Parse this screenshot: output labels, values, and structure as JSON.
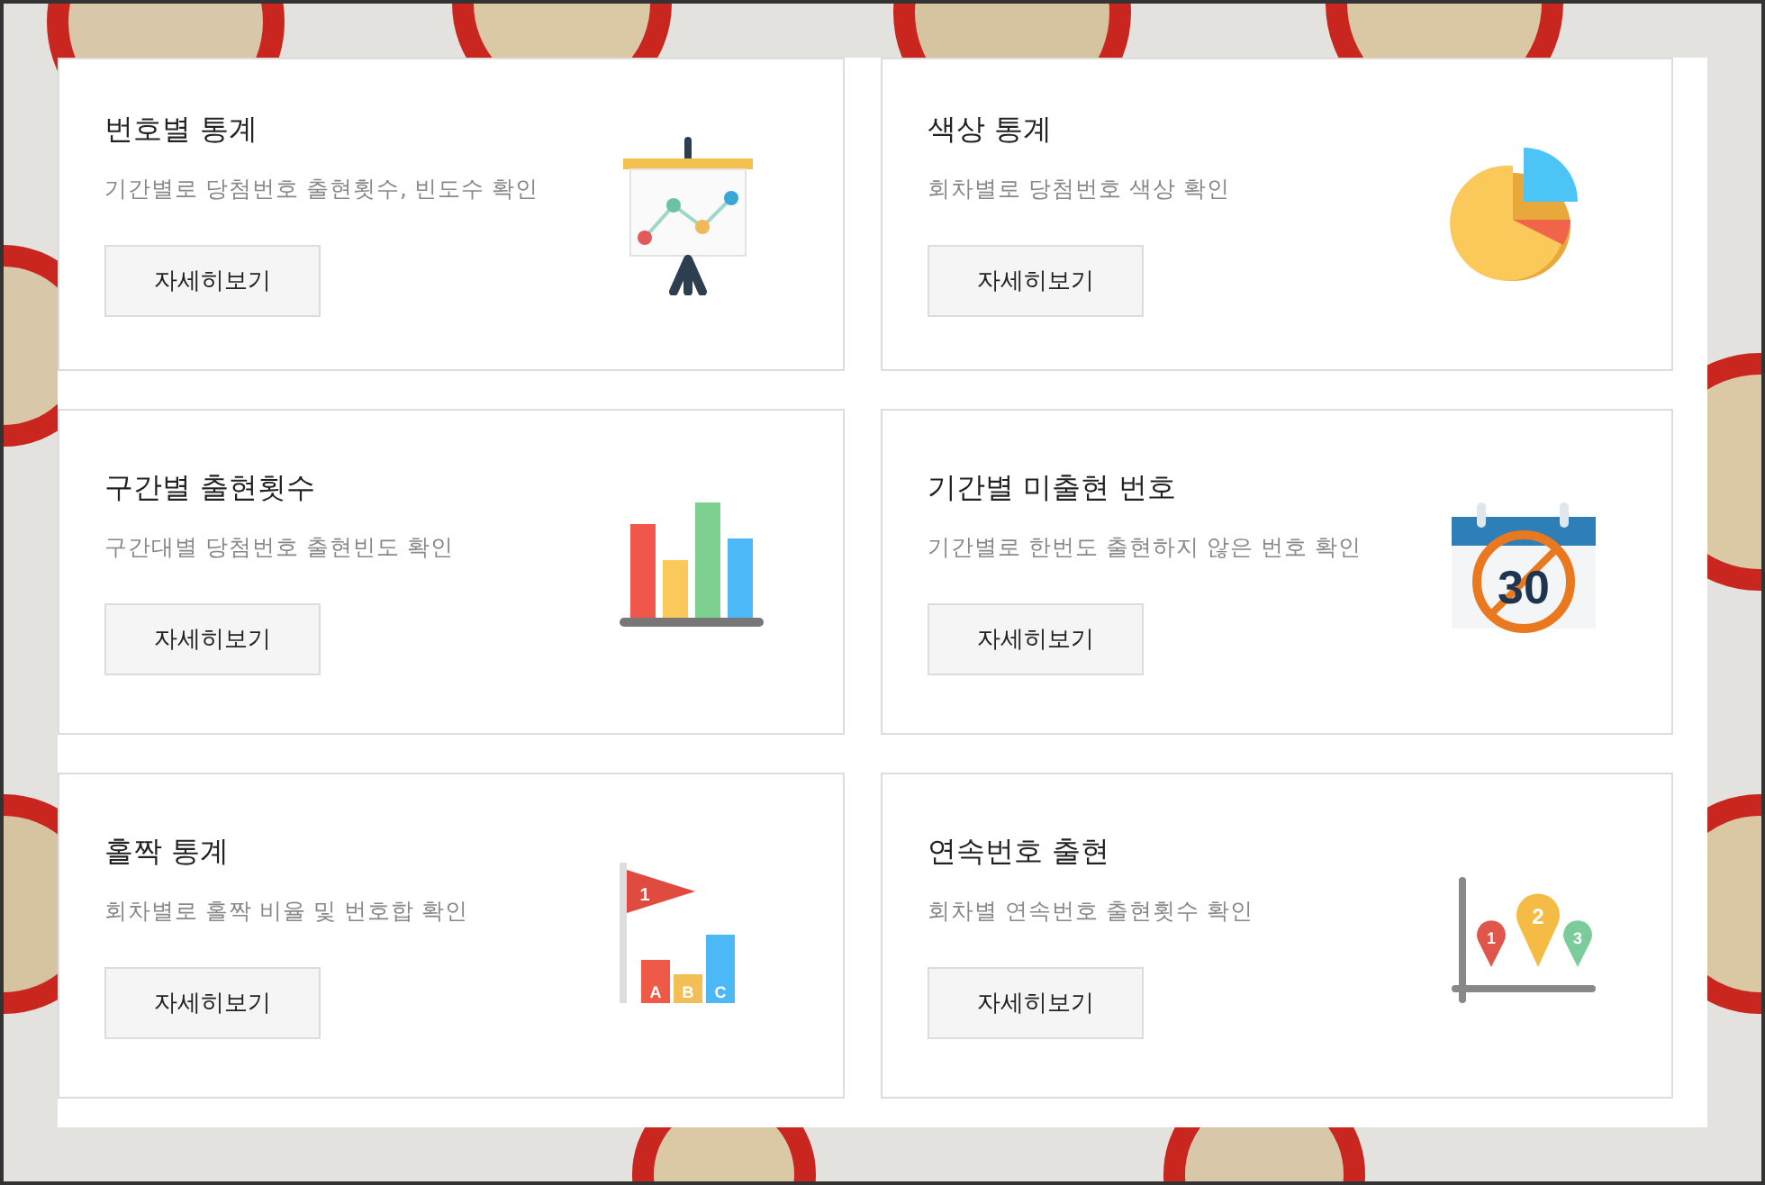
{
  "cards": [
    {
      "title": "번호별 통계",
      "description": "기간별로 당첨번호 출현횟수, 빈도수 확인",
      "button": "자세히보기",
      "icon": {
        "kind": "presentation"
      }
    },
    {
      "title": "색상 통계",
      "description": "회차별로 당첨번호 색상 확인",
      "button": "자세히보기",
      "icon": {
        "kind": "pie"
      }
    },
    {
      "title": "구간별 출현횟수",
      "description": "구간대별 당첨번호 출현빈도 확인",
      "button": "자세히보기",
      "icon": {
        "kind": "bars"
      }
    },
    {
      "title": "기간별 미출현 번호",
      "description": "기간별로 한번도 출현하지 않은 번호 확인",
      "button": "자세히보기",
      "icon": {
        "kind": "calendar",
        "labels": [
          "30"
        ]
      }
    },
    {
      "title": "홀짝 통계",
      "description": "회차별로 홀짝 비율 및 번호합 확인",
      "button": "자세히보기",
      "icon": {
        "kind": "flag",
        "labels": [
          "1",
          "A",
          "B",
          "C"
        ]
      }
    },
    {
      "title": "연속번호 출현",
      "description": "회차별 연속번호 출현횟수 확인",
      "button": "자세히보기",
      "icon": {
        "kind": "pins",
        "labels": [
          "1",
          "2",
          "3"
        ]
      }
    }
  ]
}
